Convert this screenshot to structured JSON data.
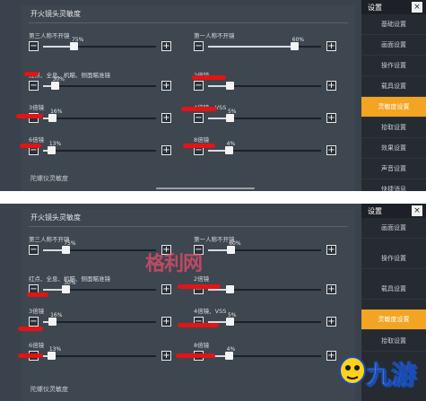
{
  "screens": [
    {
      "section_title": "开火镜头灵敏度",
      "footer_title": "陀螺仪灵敏度",
      "sidebar": {
        "title": "设置",
        "close": "×",
        "items": [
          {
            "label": "基础设置",
            "active": false
          },
          {
            "label": "画面设置",
            "active": false
          },
          {
            "label": "操作设置",
            "active": false
          },
          {
            "label": "载具设置",
            "active": false
          },
          {
            "label": "灵敏度设置",
            "active": true
          },
          {
            "label": "拾取设置",
            "active": false
          },
          {
            "label": "效果设置",
            "active": false
          },
          {
            "label": "声音设置",
            "active": false
          },
          {
            "label": "快捷消息",
            "active": false
          }
        ]
      },
      "sliders": [
        {
          "label": "第三人称不开镜",
          "value": "75%",
          "fraction": 0.27
        },
        {
          "label": "第一人称不开镜",
          "value": "60%",
          "fraction": 0.76
        },
        {
          "label": "红点、全息、机瞄、侧面瞄准镜",
          "value": "30%",
          "fraction": 0.1
        },
        {
          "label": "2倍镜",
          "value": "",
          "fraction": 0.19
        },
        {
          "label": "3倍镜",
          "value": "16%",
          "fraction": 0.08
        },
        {
          "label": "4倍镜、VSS",
          "value": "5%",
          "fraction": 0.19
        },
        {
          "label": "6倍镜",
          "value": "13%",
          "fraction": 0.07
        },
        {
          "label": "8倍镜",
          "value": "4%",
          "fraction": 0.18
        }
      ]
    },
    {
      "section_title": "开火镜头灵敏度",
      "footer_title": "陀螺仪灵敏度",
      "sidebar": {
        "title": "设置",
        "close": "×",
        "items": [
          {
            "label": "画面设置",
            "active": false
          },
          {
            "label": "操作设置",
            "active": false
          },
          {
            "label": "载具设置",
            "active": false
          },
          {
            "label": "灵敏度设置",
            "active": true
          },
          {
            "label": "拾取设置",
            "active": false
          }
        ]
      },
      "sliders": [
        {
          "label": "第三人称不开镜",
          "value": "75%",
          "fraction": 0.2
        },
        {
          "label": "第一人称不开镜",
          "value": "60%",
          "fraction": 0.2
        },
        {
          "label": "红点、全息、机瞄、侧面瞄准镜",
          "value": "30%",
          "fraction": 0.2
        },
        {
          "label": "2倍镜",
          "value": "",
          "fraction": 0.19
        },
        {
          "label": "3倍镜",
          "value": "16%",
          "fraction": 0.08
        },
        {
          "label": "4倍镜、VSS",
          "value": "5%",
          "fraction": 0.19
        },
        {
          "label": "6倍镜",
          "value": "13%",
          "fraction": 0.07
        },
        {
          "label": "8倍镜",
          "value": "4%",
          "fraction": 0.18
        }
      ]
    }
  ],
  "watermark": {
    "text": "格利网"
  },
  "logo": {
    "text": "九游"
  }
}
